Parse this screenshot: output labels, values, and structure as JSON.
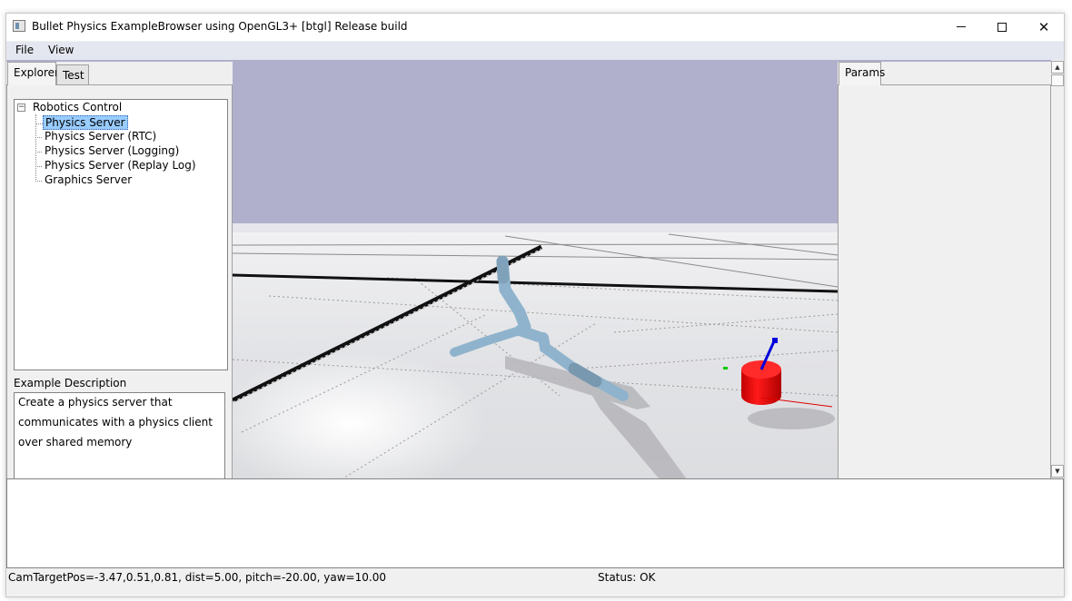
{
  "window": {
    "title": "Bullet Physics ExampleBrowser using OpenGL3+ [btgl] Release build",
    "min_symbol": "—",
    "close_symbol": "✕",
    "icons": {
      "app": "app-icon",
      "minimize": "minimize-icon",
      "maximize": "maximize-icon",
      "close": "close-icon"
    }
  },
  "menubar": {
    "file": "File",
    "view": "View"
  },
  "left_panel": {
    "tabs": [
      {
        "label": "Explorer",
        "active": true
      },
      {
        "label": "Test",
        "active": false
      }
    ],
    "tree": {
      "expand_symbol": "−",
      "root": "Robotics Control",
      "items": [
        {
          "label": "Physics Server",
          "selected": true
        },
        {
          "label": "Physics Server (RTC)",
          "selected": false
        },
        {
          "label": "Physics Server (Logging)",
          "selected": false
        },
        {
          "label": "Physics Server (Replay Log)",
          "selected": false
        },
        {
          "label": "Graphics Server",
          "selected": false
        }
      ]
    },
    "description_label": "Example Description",
    "description_lines": [
      "Create a physics server that",
      "communicates with a physics client",
      "over shared memory"
    ]
  },
  "viewport": {
    "sky_color": "#b0b0cc",
    "ground_color": "#e3e4e7",
    "robot_color": "#8fb3cc",
    "cube_color": "#ee1111",
    "axis_colors": {
      "x": "#dd0000",
      "y": "#00cc00",
      "z": "#0000dd"
    }
  },
  "right_panel": {
    "tab_label": "Params"
  },
  "scrollbar": {
    "up_symbol": "▲",
    "down_symbol": "▼"
  },
  "status": {
    "left": "CamTargetPos=-3.47,0.51,0.81, dist=5.00, pitch=-20.00, yaw=10.00",
    "right": "Status: OK"
  }
}
